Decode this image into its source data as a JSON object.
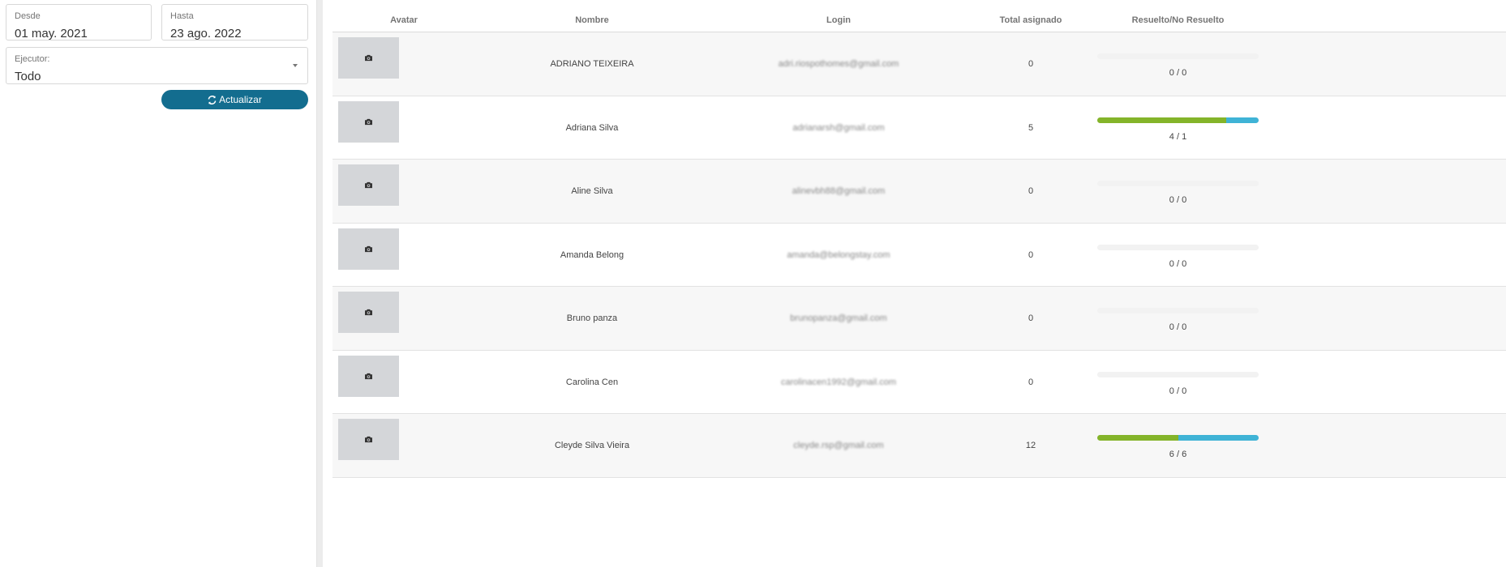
{
  "filters": {
    "desde_label": "Desde",
    "desde_value": "01 may. 2021",
    "hasta_label": "Hasta",
    "hasta_value": "23 ago. 2022",
    "ejecutor_label": "Ejecutor:",
    "ejecutor_value": "Todo",
    "update_label": "Actualizar"
  },
  "table": {
    "headers": {
      "avatar": "Avatar",
      "nombre": "Nombre",
      "login": "Login",
      "total": "Total asignado",
      "resuelto": "Resuelto/No Resuelto"
    },
    "rows": [
      {
        "nombre": "ADRIANO TEIXEIRA",
        "login": "adri.riospothomes@gmail.com",
        "total": "0",
        "resuelto": 0,
        "no_resuelto": 0,
        "ratio": "0 / 0"
      },
      {
        "nombre": "Adriana Silva",
        "login": "adrianarsh@gmail.com",
        "total": "5",
        "resuelto": 4,
        "no_resuelto": 1,
        "ratio": "4 / 1"
      },
      {
        "nombre": "Aline Silva",
        "login": "alinevbh88@gmail.com",
        "total": "0",
        "resuelto": 0,
        "no_resuelto": 0,
        "ratio": "0 / 0"
      },
      {
        "nombre": "Amanda Belong",
        "login": "amanda@belongstay.com",
        "total": "0",
        "resuelto": 0,
        "no_resuelto": 0,
        "ratio": "0 / 0"
      },
      {
        "nombre": "Bruno panza",
        "login": "brunopanza@gmail.com",
        "total": "0",
        "resuelto": 0,
        "no_resuelto": 0,
        "ratio": "0 / 0"
      },
      {
        "nombre": "Carolina Cen",
        "login": "carolinacen1992@gmail.com",
        "total": "0",
        "resuelto": 0,
        "no_resuelto": 0,
        "ratio": "0 / 0"
      },
      {
        "nombre": "Cleyde Silva Vieira",
        "login": "cleyde.rsp@gmail.com",
        "total": "12",
        "resuelto": 6,
        "no_resuelto": 6,
        "ratio": "6 / 6"
      }
    ]
  },
  "colors": {
    "accent": "#136d8f",
    "resuelto": "#84b42a",
    "no_resuelto": "#3fb3d6",
    "avatar_placeholder": "#d4d6d9"
  },
  "icons": {
    "update": "refresh-icon",
    "avatar": "camera-icon",
    "dropdown": "caret-down-icon"
  }
}
